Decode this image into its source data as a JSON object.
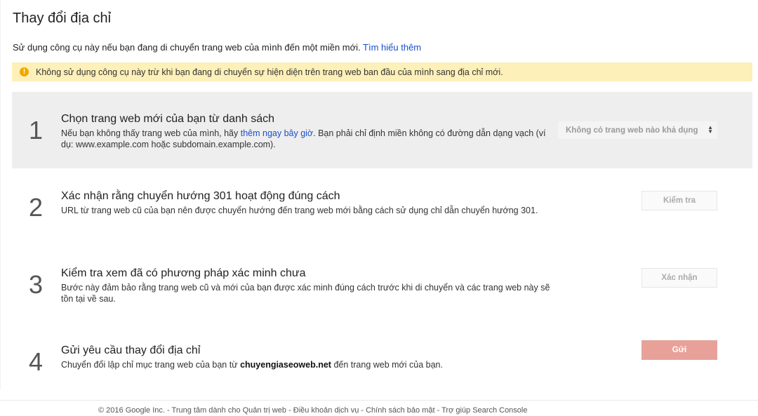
{
  "page": {
    "title": "Thay đổi địa chỉ",
    "intro_text": "Sử dụng công cụ này nếu bạn đang di chuyển trang web của mình đến một miền mới.",
    "intro_link": "Tìm hiểu thêm"
  },
  "warning": {
    "icon": "warning-icon",
    "text": "Không sử dụng công cụ này trừ khi bạn đang di chuyển sự hiện diện trên trang web ban đầu của mình sang địa chỉ mới."
  },
  "steps": [
    {
      "number": "1",
      "title": "Chọn trang web mới của bạn từ danh sách",
      "desc_before": "Nếu bạn không thấy trang web của mình, hãy",
      "desc_link": "thêm ngay bây giờ",
      "desc_after": ". Bạn phải chỉ định miền không có đường dẫn dạng vạch (ví dụ: www.example.com hoặc subdomain.example.com).",
      "select_value": "Không có trang web nào khả dụng"
    },
    {
      "number": "2",
      "title": "Xác nhận rằng chuyển hướng 301 hoạt động đúng cách",
      "desc": "URL từ trang web cũ của bạn nên được chuyển hướng đến trang web mới bằng cách sử dụng chỉ dẫn chuyển hướng 301.",
      "button": "Kiểm tra"
    },
    {
      "number": "3",
      "title": "Kiểm tra xem đã có phương pháp xác minh chưa",
      "desc": "Bước này đảm bảo rằng trang web cũ và mới của bạn được xác minh đúng cách trước khi di chuyển và các trang web này sẽ tồn tại về sau.",
      "button": "Xác nhận"
    },
    {
      "number": "4",
      "title": "Gửi yêu cầu thay đổi địa chỉ",
      "desc_before": "Chuyển đổi lập chỉ mục trang web của bạn từ",
      "desc_domain": "chuyengiaseoweb.net",
      "desc_after": "đến trang web mới của bạn.",
      "button": "Gửi"
    }
  ],
  "footer": {
    "text": "© 2016 Google Inc. - Trung tâm dành cho Quản trị web - Điều khoản dịch vụ - Chính sách bảo mật - Trợ giúp Search Console"
  },
  "colors": {
    "warning_bg": "#fdf0b8",
    "active_step_bg": "#eeeeee",
    "submit_button": "#e8a199",
    "link": "#1a4fc9"
  }
}
